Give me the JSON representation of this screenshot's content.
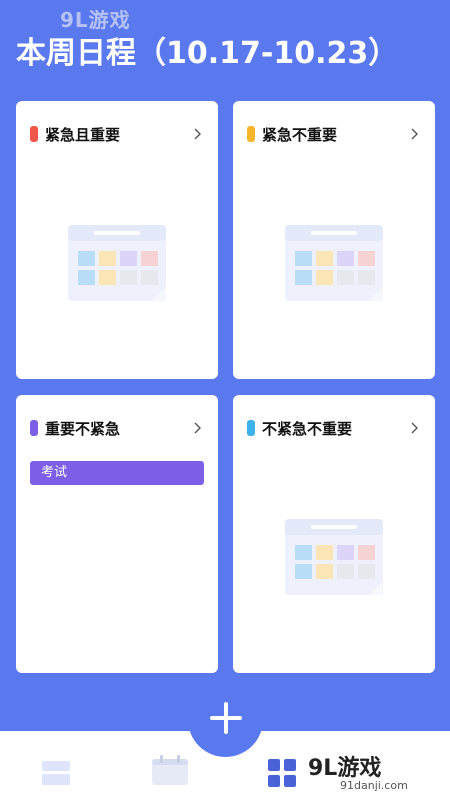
{
  "header": {
    "watermark": "9L游戏",
    "title": "本周日程（10.17-10.23）"
  },
  "colors": {
    "background": "#5b79ee",
    "urgent_important": "#f0574a",
    "urgent_not_important": "#f7b52c",
    "important_not_urgent": "#7d5ee6",
    "not_urgent_not_important": "#3cb0e8"
  },
  "quadrants": [
    {
      "title": "紧急且重要",
      "tag_color": "#f0574a",
      "chevron_icon": "chevron-right-icon",
      "empty": true
    },
    {
      "title": "紧急不重要",
      "tag_color": "#f7b52c",
      "chevron_icon": "chevron-right-icon",
      "empty": true
    },
    {
      "title": "重要不紧急",
      "tag_color": "#7d5ee6",
      "chevron_icon": "chevron-right-icon",
      "empty": false,
      "tasks": [
        "考试"
      ]
    },
    {
      "title": "不紧急不重要",
      "tag_color": "#3cb0e8",
      "chevron_icon": "chevron-right-icon",
      "empty": true
    }
  ],
  "fab": {
    "icon": "plus-icon"
  },
  "bottom_tabs": [
    {
      "icon": "list-icon"
    },
    {
      "icon": "calendar-icon"
    },
    {
      "icon": "grid-icon"
    }
  ],
  "watermark_bottom": {
    "logo": "9L游戏",
    "url": "91danji.com"
  }
}
